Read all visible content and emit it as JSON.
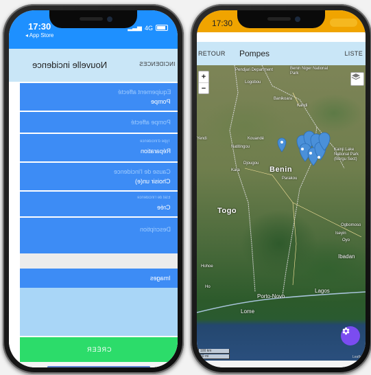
{
  "left": {
    "status": {
      "time": "17:30",
      "back_app": "◂ App Store",
      "network": "4G"
    },
    "header": {
      "title": "Nouvelle incidence",
      "back_label": "INCIDENCES"
    },
    "fields": [
      {
        "label": "Equipement affecté",
        "value": "Pompe"
      },
      {
        "label": "Pompe affecté",
        "value": ""
      },
      {
        "label": "Type d'incidence",
        "value": "Réparation"
      },
      {
        "label": "Cause de l'incidence",
        "value": "Choisir un(e)"
      },
      {
        "label": "Etat de l'incidence",
        "value": "Crée"
      },
      {
        "label": "Description",
        "value": ""
      }
    ],
    "images_label": "Images",
    "create_button": "CRÉER"
  },
  "right": {
    "status": {
      "time": "17:30"
    },
    "header": {
      "back_label": "RETOUR",
      "title": "Pompes",
      "list_label": "LISTE"
    },
    "map": {
      "zoom_in": "+",
      "zoom_out": "−",
      "labels": {
        "benin": "Benin",
        "togo": "Togo",
        "parakou": "Parakou",
        "natitingou": "Natitingou",
        "djougou": "Djougou",
        "kara": "Kara",
        "kouande": "Kouandé",
        "kandi": "Kandi",
        "banikoara": "Banikoara",
        "logobou": "Logobou",
        "pendjari": "Pendjari Department",
        "niger_park": "Benin Niger National Park",
        "kainji": "Kainji Lake National Park (Borgu Sect)",
        "yendi": "Yendi",
        "porto_novo": "Porto-Novo",
        "lome": "Lome",
        "lagos": "Lagos",
        "ibadan": "Ibadan",
        "ogbomoso": "Ogbomoso",
        "iseyin": "Iseyin",
        "oyo": "Oyo",
        "hohoe": "Hohoe",
        "ho": "Ho"
      },
      "scale_km": "100 km",
      "scale_mi": "50 mi",
      "attribution": "Leaflet"
    }
  }
}
